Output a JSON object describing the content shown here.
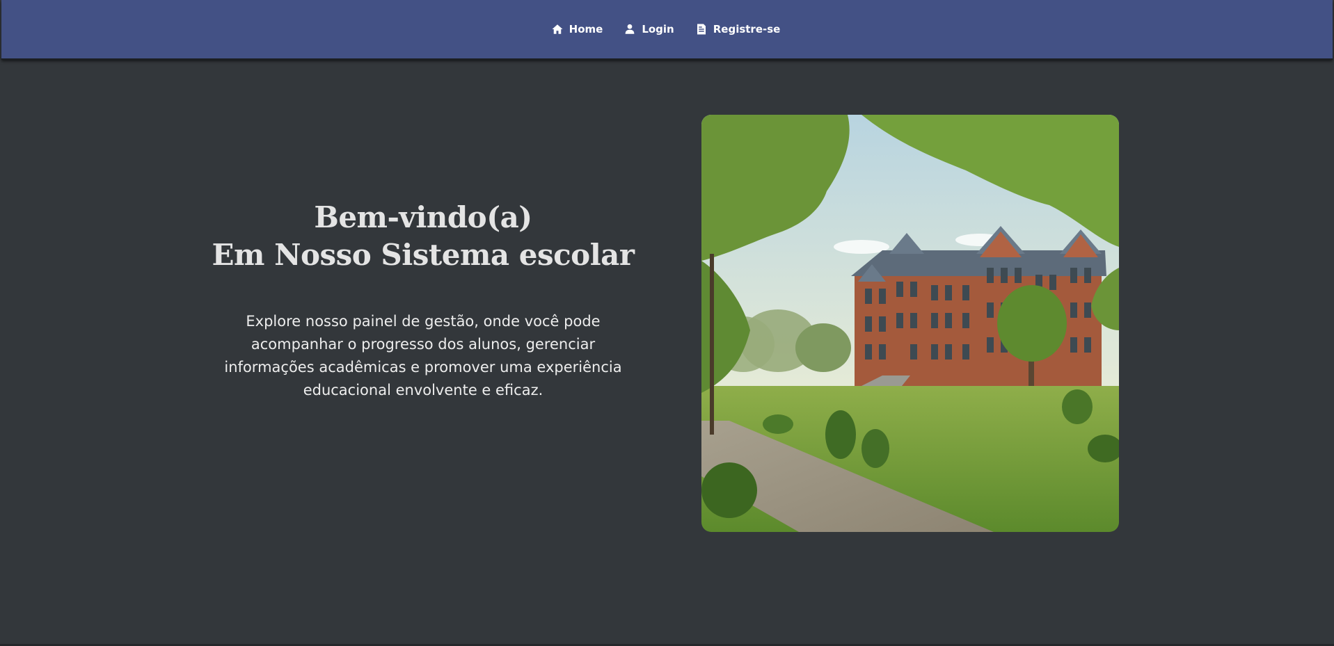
{
  "nav": {
    "items": [
      {
        "label": "Home",
        "icon": "home-icon"
      },
      {
        "label": "Login",
        "icon": "user-icon"
      },
      {
        "label": "Registre-se",
        "icon": "register-icon"
      }
    ]
  },
  "hero": {
    "title_line1": "Bem-vindo(a)",
    "title_line2": "Em Nosso Sistema escolar",
    "description": "Explore nosso painel de gestão, onde você pode acompanhar o progresso dos alunos, gerenciar informações acadêmicas e promover uma experiência educacional envolvente e eficaz.",
    "image": "school-campus-illustration"
  },
  "colors": {
    "navbar": "#435185",
    "background": "#33373b",
    "text": "#e4e4e4"
  }
}
